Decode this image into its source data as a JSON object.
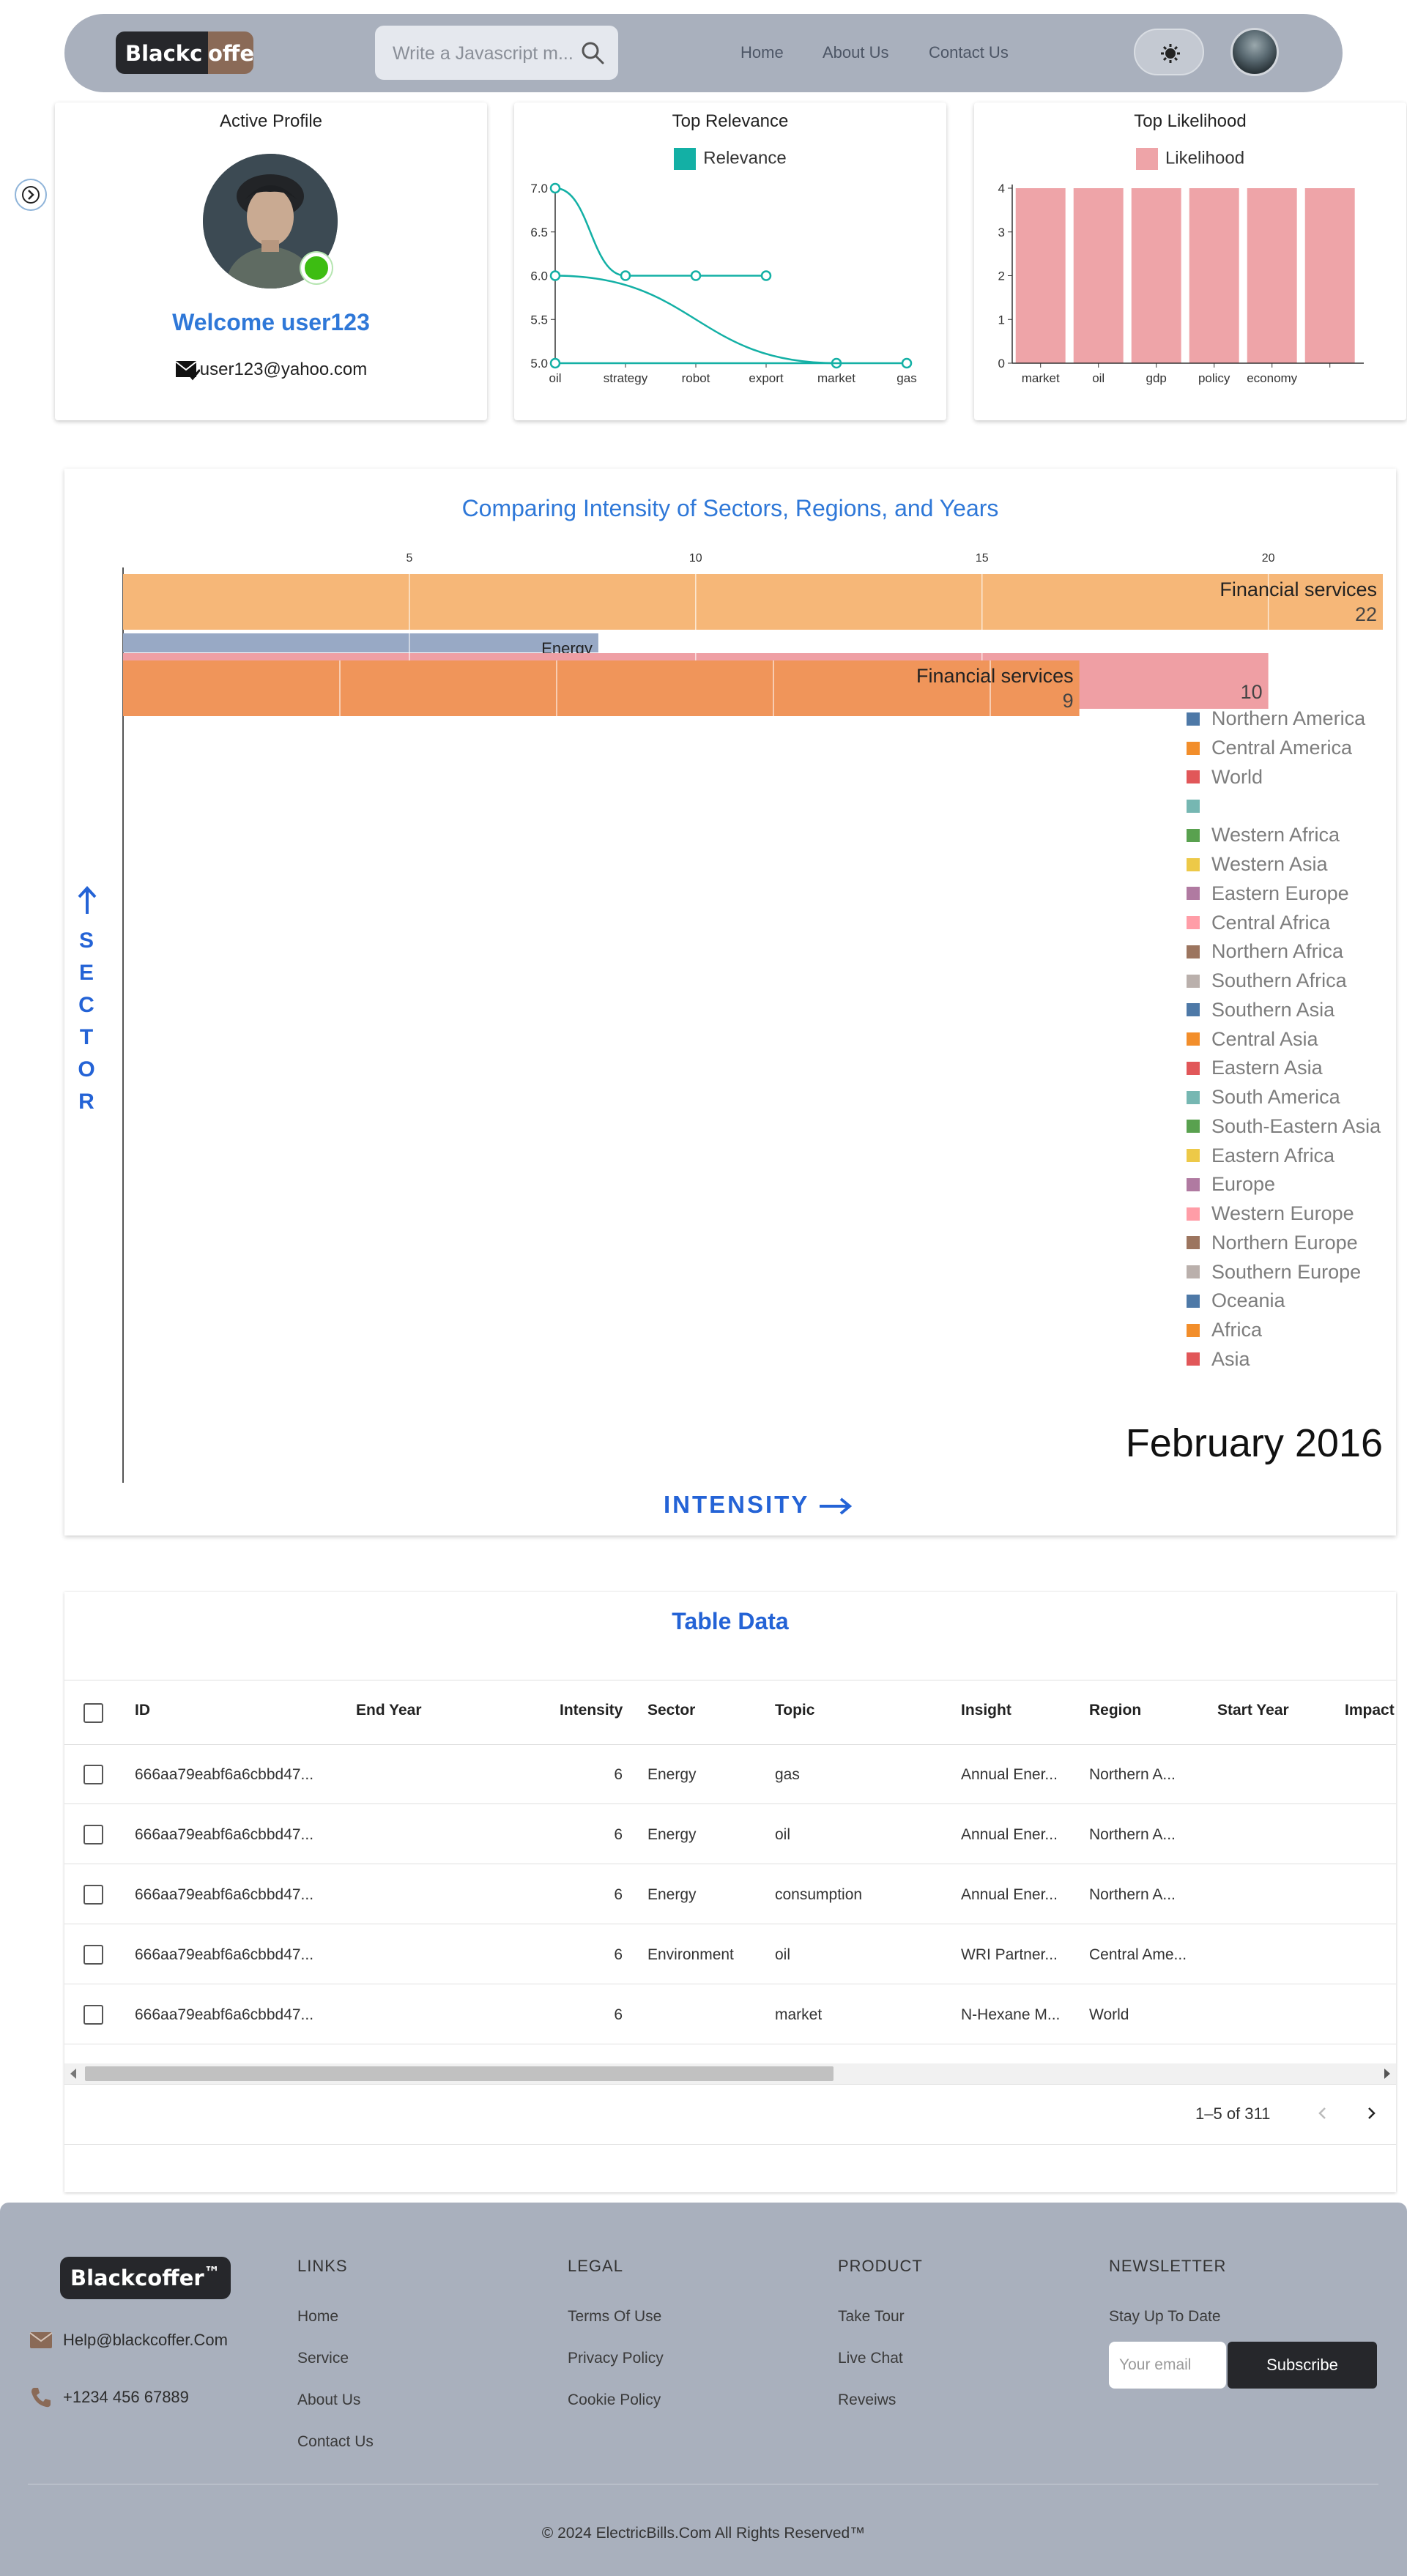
{
  "nav": {
    "logo_part1": "Blackc",
    "logo_part2": "offer",
    "search_placeholder": "Write a Javascript m...",
    "links": [
      "Home",
      "About Us",
      "Contact Us"
    ]
  },
  "profile_card": {
    "title": "Active Profile",
    "welcome": "Welcome user123",
    "email": "user123@yahoo.com"
  },
  "relevance_card": {
    "title": "Top Relevance",
    "legend": "Relevance",
    "color": "#13b0a5"
  },
  "likelihood_card": {
    "title": "Top Likelihood",
    "legend": "Likelihood",
    "color": "#eea4a8"
  },
  "chart_data": [
    {
      "type": "line",
      "x": [
        "oil",
        "strategy",
        "robot",
        "export",
        "market",
        "gas"
      ],
      "y_ticks": [
        "7.0",
        "6.5",
        "6.0",
        "5.5",
        "5.0"
      ],
      "ylim": [
        5.0,
        7.0
      ],
      "series": [
        {
          "name": "Relevance",
          "points": [
            [
              "oil",
              7.0
            ],
            [
              "strategy",
              6.0
            ],
            [
              "robot",
              6.0
            ],
            [
              "export",
              6.0
            ]
          ]
        },
        {
          "name": "Relevance",
          "points": [
            [
              "oil",
              6.0
            ],
            [
              "market",
              5.0
            ]
          ]
        },
        {
          "name": "Relevance",
          "points": [
            [
              "oil",
              5.0
            ],
            [
              "gas",
              5.0
            ]
          ]
        }
      ]
    },
    {
      "type": "bar",
      "categories": [
        "market",
        "oil",
        "gdp",
        "policy",
        "economy",
        ""
      ],
      "values": [
        4,
        4,
        4,
        4,
        4,
        4
      ],
      "y_ticks": [
        "4",
        "3",
        "2",
        "1",
        "0"
      ],
      "ylim": [
        0,
        4
      ],
      "series": [
        {
          "name": "Likelihood",
          "values": [
            4,
            4,
            4,
            4,
            4,
            4
          ]
        }
      ]
    },
    {
      "type": "bar",
      "title": "Comparing Intensity of Sectors, Regions, and Years",
      "xlabel": "INTENSITY",
      "ylabel": "SECTOR",
      "x_ticks": [
        "5",
        "10",
        "15",
        "20"
      ],
      "xlim": [
        0,
        22
      ],
      "date_label": "February 2016",
      "bars": [
        {
          "label": "Financial services",
          "value": 22,
          "value_text": "22",
          "color": "#f6b778"
        },
        {
          "label": "Energy",
          "value": 8.3,
          "value_text": "",
          "color": "#98a9c5"
        },
        {
          "label": "",
          "value": 20,
          "value_text": "10",
          "color": "#ef9fa4"
        },
        {
          "label": "Financial services",
          "value": 16.7,
          "value_text": "9",
          "color": "#f0955a"
        }
      ],
      "legend": [
        {
          "name": "Northern America",
          "color": "#4e79a7"
        },
        {
          "name": "Central America",
          "color": "#f28e2b"
        },
        {
          "name": "World",
          "color": "#e15759"
        },
        {
          "name": "",
          "color": "#76b7b2"
        },
        {
          "name": "Western Africa",
          "color": "#59a14f"
        },
        {
          "name": "Western Asia",
          "color": "#edc948"
        },
        {
          "name": "Eastern Europe",
          "color": "#b07aa1"
        },
        {
          "name": "Central Africa",
          "color": "#ff9da7"
        },
        {
          "name": "Northern Africa",
          "color": "#9c755f"
        },
        {
          "name": "Southern Africa",
          "color": "#bab0ac"
        },
        {
          "name": "Southern Asia",
          "color": "#4e79a7"
        },
        {
          "name": "Central Asia",
          "color": "#f28e2b"
        },
        {
          "name": "Eastern Asia",
          "color": "#e15759"
        },
        {
          "name": "South America",
          "color": "#76b7b2"
        },
        {
          "name": "South-Eastern Asia",
          "color": "#59a14f"
        },
        {
          "name": "Eastern Africa",
          "color": "#edc948"
        },
        {
          "name": "Europe",
          "color": "#b07aa1"
        },
        {
          "name": "Western Europe",
          "color": "#ff9da7"
        },
        {
          "name": "Northern Europe",
          "color": "#9c755f"
        },
        {
          "name": "Southern Europe",
          "color": "#bab0ac"
        },
        {
          "name": "Oceania",
          "color": "#4e79a7"
        },
        {
          "name": "Africa",
          "color": "#f28e2b"
        },
        {
          "name": "Asia",
          "color": "#e15759"
        }
      ]
    }
  ],
  "table": {
    "title": "Table Data",
    "columns": [
      "ID",
      "End Year",
      "Intensity",
      "Sector",
      "Topic",
      "Insight",
      "Region",
      "Start Year",
      "Impact"
    ],
    "rows": [
      {
        "id": "666aa79eabf6a6cbbd47...",
        "end_year": "",
        "intensity": "6",
        "sector": "Energy",
        "topic": "gas",
        "insight": "Annual Ener...",
        "region": "Northern A...",
        "start_year": ""
      },
      {
        "id": "666aa79eabf6a6cbbd47...",
        "end_year": "",
        "intensity": "6",
        "sector": "Energy",
        "topic": "oil",
        "insight": "Annual Ener...",
        "region": "Northern A...",
        "start_year": ""
      },
      {
        "id": "666aa79eabf6a6cbbd47...",
        "end_year": "",
        "intensity": "6",
        "sector": "Energy",
        "topic": "consumption",
        "insight": "Annual Ener...",
        "region": "Northern A...",
        "start_year": ""
      },
      {
        "id": "666aa79eabf6a6cbbd47...",
        "end_year": "",
        "intensity": "6",
        "sector": "Environment",
        "topic": "oil",
        "insight": "WRI Partner...",
        "region": "Central Ame...",
        "start_year": ""
      },
      {
        "id": "666aa79eabf6a6cbbd47...",
        "end_year": "",
        "intensity": "6",
        "sector": "",
        "topic": "market",
        "insight": "N-Hexane M...",
        "region": "World",
        "start_year": ""
      }
    ],
    "pagination": "1–5 of 311"
  },
  "footer": {
    "logo": "Blackcoffer",
    "logo_tm": "™",
    "email": "Help@blackcoffer.Com",
    "phone": "+1234 456 67889",
    "links_title": "LINKS",
    "links": [
      "Home",
      "Service",
      "About Us",
      "Contact Us"
    ],
    "legal_title": "LEGAL",
    "legal": [
      "Terms Of Use",
      "Privacy Policy",
      "Cookie Policy"
    ],
    "product_title": "PRODUCT",
    "product": [
      "Take Tour",
      "Live Chat",
      "Reveiws"
    ],
    "newsletter_title": "NEWSLETTER",
    "newsletter_text": "Stay Up To Date",
    "email_placeholder": "Your email",
    "subscribe_label": "Subscribe",
    "copyright": "© 2024 ElectricBills.Com All Rights Reserved™"
  }
}
